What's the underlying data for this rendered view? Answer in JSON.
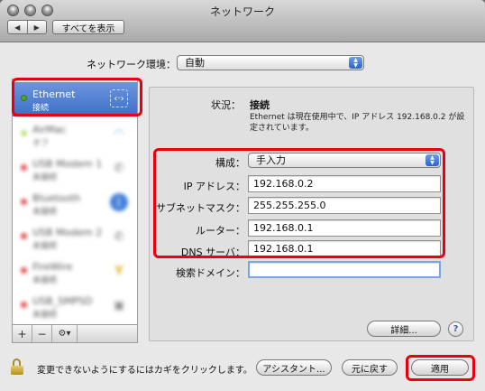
{
  "window": {
    "title": "ネットワーク"
  },
  "toolbar": {
    "back_glyph": "◀",
    "forward_glyph": "▶",
    "show_all_label": "すべてを表示"
  },
  "location": {
    "label": "ネットワーク環境：",
    "value": "自動"
  },
  "sidebar": {
    "selected": {
      "name": "Ethernet",
      "status": "接続",
      "icon": "ethernet-arrows-icon",
      "glyph": "‹·›"
    },
    "items": [
      {
        "name": "AirMac",
        "status": "オフ",
        "icon": "wifi-icon",
        "glyph": "◠"
      },
      {
        "name": "USB Modem 1",
        "status": "未接続",
        "icon": "phone-icon",
        "glyph": "✆"
      },
      {
        "name": "Bluetooth",
        "status": "未接続",
        "icon": "bluetooth-icon",
        "glyph": "ᛒ"
      },
      {
        "name": "USB Modem 2",
        "status": "未接続",
        "icon": "phone-icon",
        "glyph": "✆"
      },
      {
        "name": "FireWire",
        "status": "未接続",
        "icon": "firewire-icon",
        "glyph": "Y"
      },
      {
        "name": "USB_SMPSD",
        "status": "未接続",
        "icon": "vpn-icon",
        "glyph": "▣"
      }
    ],
    "add_glyph": "+",
    "remove_glyph": "−",
    "gear_glyph": "⚙▾"
  },
  "status": {
    "label": "状況：",
    "value": "接続",
    "description": "Ethernet は現在使用中で、IP アドレス 192.168.0.2 が設定されています。"
  },
  "config": {
    "method_label": "構成：",
    "method_value": "手入力",
    "ip_label": "IP アドレス：",
    "ip_value": "192.168.0.2",
    "subnet_label": "サブネットマスク：",
    "subnet_value": "255.255.255.0",
    "router_label": "ルーター：",
    "router_value": "192.168.0.1",
    "dns_label": "DNS サーバ：",
    "dns_value": "192.168.0.1",
    "search_label": "検索ドメイン：",
    "search_value": ""
  },
  "buttons": {
    "advanced": "詳細...",
    "help": "?",
    "assistant": "アシスタント...",
    "revert": "元に戻す",
    "apply": "適用"
  },
  "lock": {
    "text": "変更できないようにするにはカギをクリックします。"
  },
  "colors": {
    "highlight": "#e8000f",
    "selection": "#3e6ec7",
    "status_connected": "#4fa52e"
  }
}
